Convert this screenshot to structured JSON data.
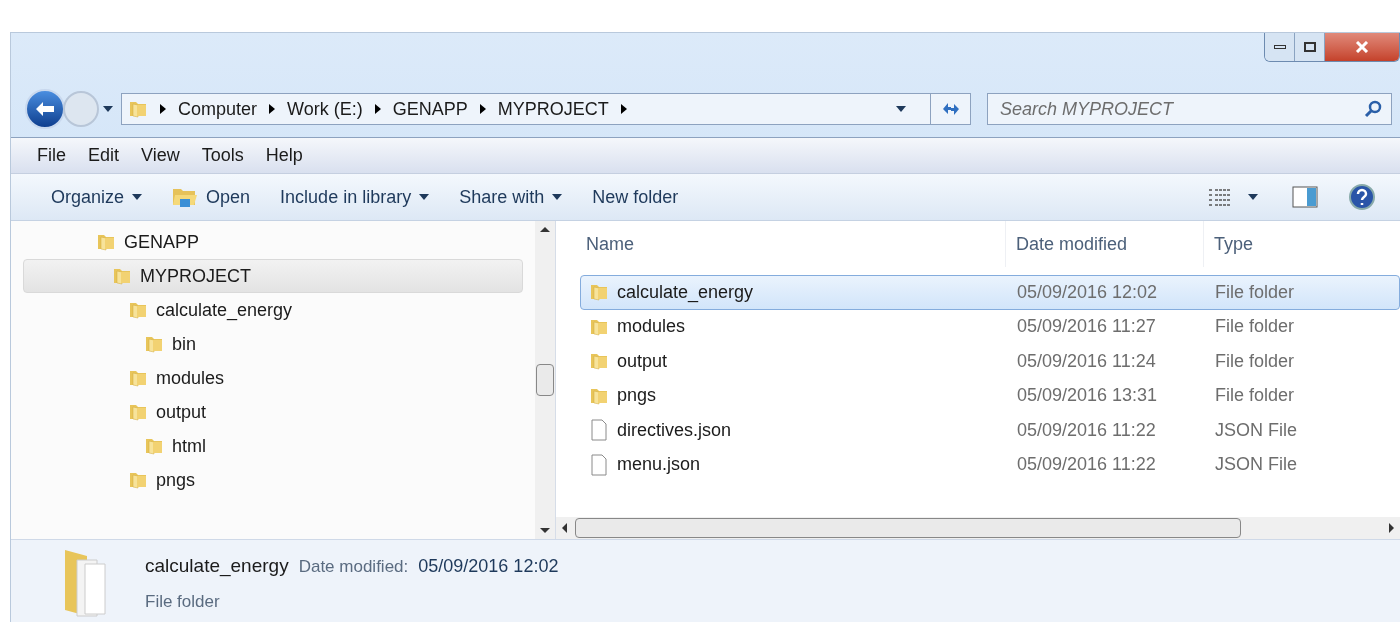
{
  "address_bar": {
    "crumbs": [
      "Computer",
      "Work (E:)",
      "GENAPP",
      "MYPROJECT"
    ]
  },
  "search": {
    "placeholder": "Search MYPROJECT"
  },
  "menu_bar": [
    "File",
    "Edit",
    "View",
    "Tools",
    "Help"
  ],
  "toolbar": [
    {
      "label": "Organize",
      "kind": "dropdown"
    },
    {
      "label": "Open",
      "kind": "open"
    },
    {
      "label": "Include in library",
      "kind": "dropdown"
    },
    {
      "label": "Share with",
      "kind": "dropdown"
    },
    {
      "label": "New folder",
      "kind": "plain"
    }
  ],
  "tree": [
    {
      "label": "GENAPP",
      "selected": false,
      "children": [
        {
          "label": "MYPROJECT",
          "selected": true,
          "children": [
            {
              "label": "calculate_energy",
              "selected": false,
              "children": [
                {
                  "label": "bin",
                  "selected": false
                }
              ]
            },
            {
              "label": "modules",
              "selected": false
            },
            {
              "label": "output",
              "selected": false,
              "children": [
                {
                  "label": "html",
                  "selected": false
                }
              ]
            },
            {
              "label": "pngs",
              "selected": false
            }
          ]
        }
      ]
    }
  ],
  "table": {
    "columns": [
      "Name",
      "Date modified",
      "Type"
    ],
    "rows": [
      {
        "name": "calculate_energy",
        "date": "05/09/2016 12:02",
        "type": "File folder",
        "kind": "folder",
        "selected": true
      },
      {
        "name": "modules",
        "date": "05/09/2016 11:27",
        "type": "File folder",
        "kind": "folder",
        "selected": false
      },
      {
        "name": "output",
        "date": "05/09/2016 11:24",
        "type": "File folder",
        "kind": "folder",
        "selected": false
      },
      {
        "name": "pngs",
        "date": "05/09/2016 13:31",
        "type": "File folder",
        "kind": "folder",
        "selected": false
      },
      {
        "name": "directives.json",
        "date": "05/09/2016 11:22",
        "type": "JSON File",
        "kind": "file",
        "selected": false
      },
      {
        "name": "menu.json",
        "date": "05/09/2016 11:22",
        "type": "JSON File",
        "kind": "file",
        "selected": false
      }
    ]
  },
  "details": {
    "name": "calculate_energy",
    "date_label": "Date modified:",
    "date": "05/09/2016 12:02",
    "type": "File folder"
  }
}
